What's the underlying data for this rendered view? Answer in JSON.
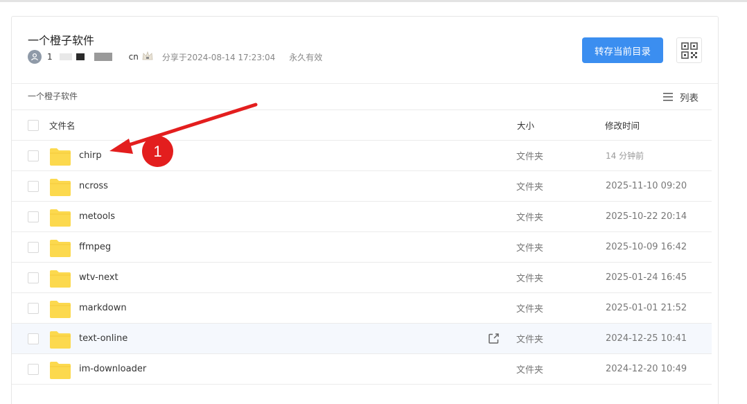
{
  "share": {
    "title": "一个橙子软件",
    "user_name_start": "1",
    "user_name_end": "cn",
    "share_time": "分享于2024-08-14 17:23:04",
    "validity": "永久有效",
    "save_button": "转存当前目录"
  },
  "breadcrumb": "一个橙子软件",
  "view_toggle": "列表",
  "table": {
    "col_name": "文件名",
    "col_size": "大小",
    "col_time": "修改时间",
    "rows": [
      {
        "name": "chirp",
        "size": "文件夹",
        "time": "14 分钟前"
      },
      {
        "name": "ncross",
        "size": "文件夹",
        "time": "2025-11-10 09:20"
      },
      {
        "name": "metools",
        "size": "文件夹",
        "time": "2025-10-22 20:14"
      },
      {
        "name": "ffmpeg",
        "size": "文件夹",
        "time": "2025-10-09 16:42"
      },
      {
        "name": "wtv-next",
        "size": "文件夹",
        "time": "2025-01-24 16:45"
      },
      {
        "name": "markdown",
        "size": "文件夹",
        "time": "2025-01-01 21:52"
      },
      {
        "name": "text-online",
        "size": "文件夹",
        "time": "2024-12-25 10:41"
      },
      {
        "name": "im-downloader",
        "size": "文件夹",
        "time": "2024-12-20 10:49"
      }
    ]
  },
  "annotation": {
    "badge": "1"
  },
  "colors": {
    "accent": "#3b8ef0",
    "folder": "#fcd94e",
    "annotation": "#e31e1e"
  },
  "icons": [
    "user-avatar-icon",
    "crown-icon",
    "qr-code-icon",
    "list-view-icon",
    "folder-icon",
    "edit-open-icon"
  ]
}
